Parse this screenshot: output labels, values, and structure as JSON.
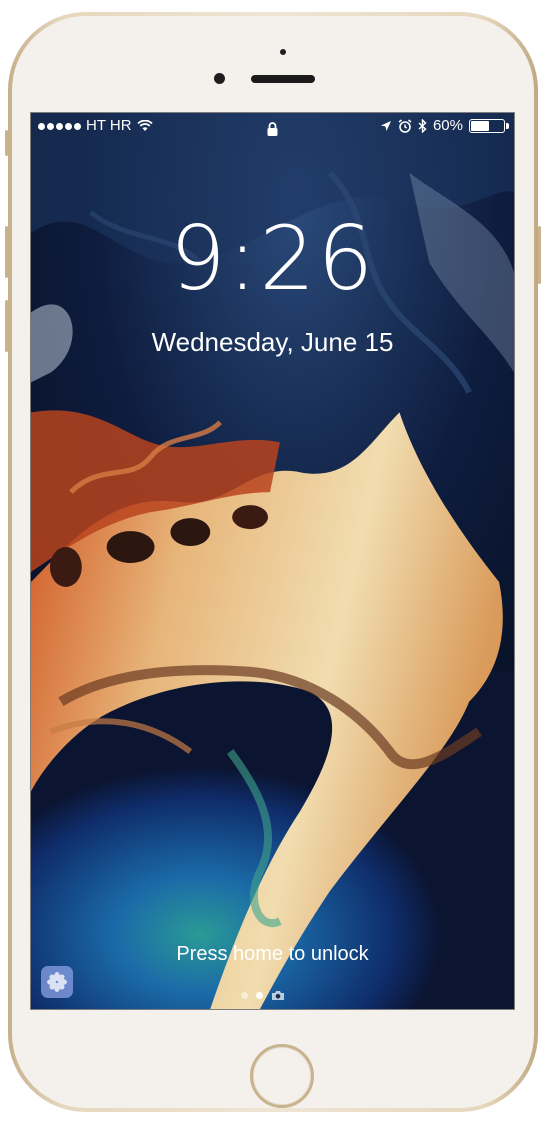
{
  "device": {
    "model": "iPhone",
    "color": "gold"
  },
  "status_bar": {
    "signal_dots": 5,
    "carrier": "HT HR",
    "icons_left": [
      "signal-icon",
      "wifi-icon"
    ],
    "icons_center": [
      "lock-icon"
    ],
    "icons_right": [
      "location-arrow-icon",
      "alarm-icon",
      "bluetooth-icon"
    ],
    "battery_percent_label": "60%",
    "battery_level": 0.6
  },
  "lock_screen": {
    "time": "9:26",
    "date": "Wednesday, June 15",
    "unlock_hint": "Press home to unlock",
    "pages": 2,
    "active_page": 1,
    "camera_shortcut_icon": "camera-icon",
    "suggested_app_icon": "photos-icon"
  },
  "colors": {
    "wallpaper_deep": "#0b1430",
    "wallpaper_sea": "#1b6aa8",
    "wallpaper_sand": "#e7b57a",
    "wallpaper_rust": "#b8431d",
    "phone_body": "#efe5d4",
    "phone_trim": "#c9b38f"
  }
}
